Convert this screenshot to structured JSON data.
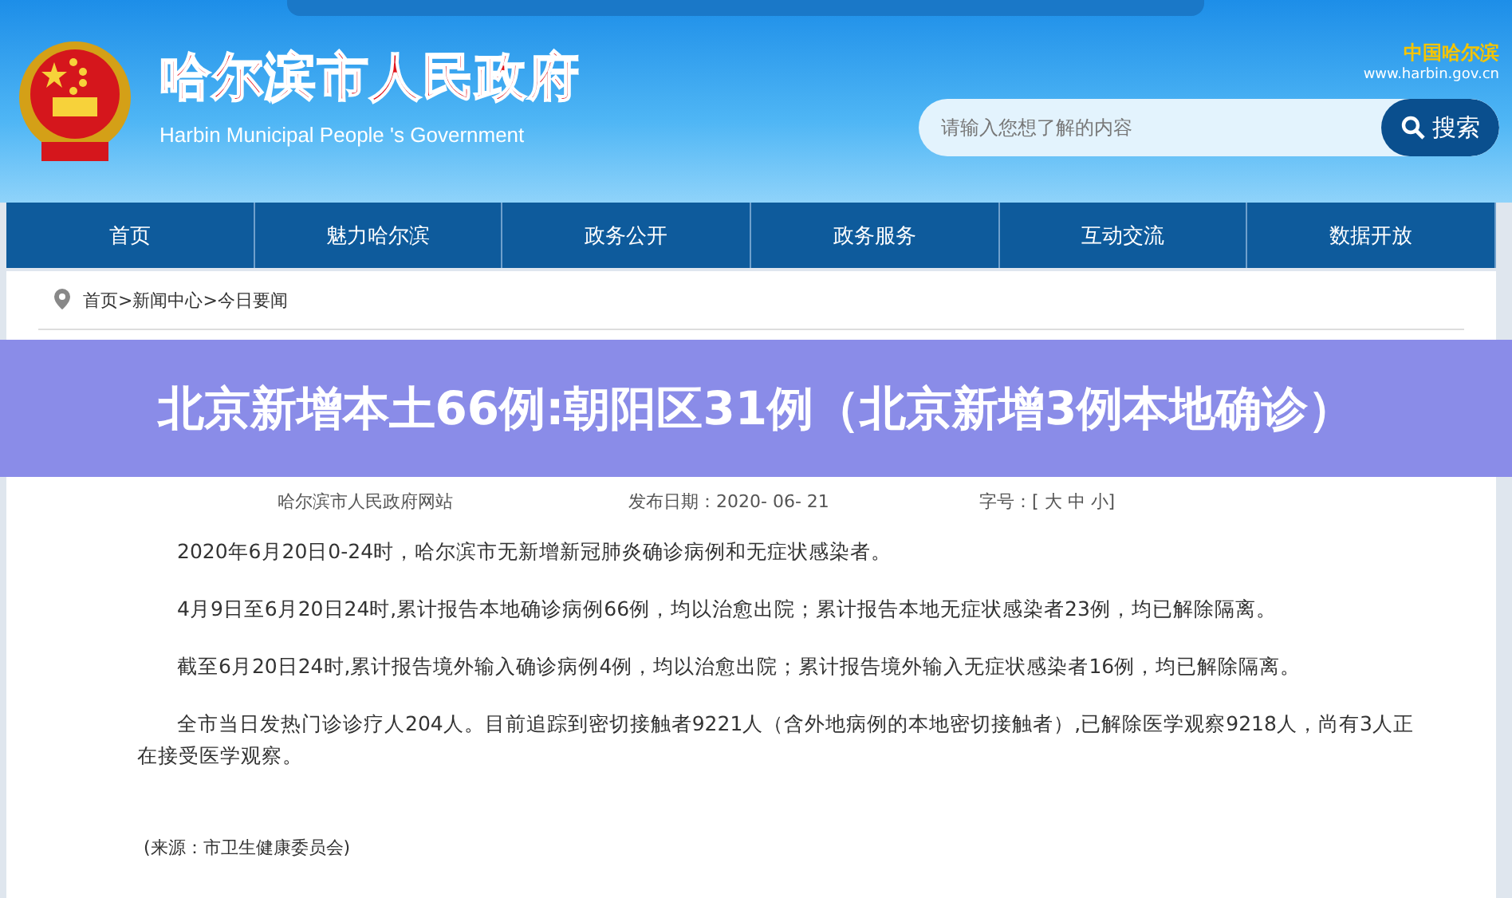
{
  "header": {
    "site_title": "哈尔滨市人民政府",
    "site_subtitle": "Harbin Municipal People 's Government",
    "city_logo": "中国哈尔滨",
    "city_url": "www.harbin.gov.cn",
    "search": {
      "placeholder": "请输入您想了解的内容",
      "button": "搜索"
    }
  },
  "nav": [
    {
      "label": "首页"
    },
    {
      "label": "魅力哈尔滨"
    },
    {
      "label": "政务公开"
    },
    {
      "label": "政务服务"
    },
    {
      "label": "互动交流"
    },
    {
      "label": "数据开放"
    }
  ],
  "breadcrumb": "首页>新闻中心>今日要闻",
  "banner": "北京新增本土66例:朝阳区31例（北京新增3例本地确诊）",
  "article": {
    "source": "哈尔滨市人民政府网站",
    "date": "发布日期：2020- 06- 21",
    "font_size": "字号：[ 大 中 小]",
    "paragraphs": [
      "2020年6月20日0-24时，哈尔滨市无新增新冠肺炎确诊病例和无症状感染者。",
      "4月9日至6月20日24时,累计报告本地确诊病例66例，均以治愈出院；累计报告本地无症状感染者23例，均已解除隔离。",
      "截至6月20日24时,累计报告境外输入确诊病例4例，均以治愈出院；累计报告境外输入无症状感染者16例，均已解除隔离。",
      "全市当日发热门诊诊疗人204人。目前追踪到密切接触者9221人（含外地病例的本地密切接触者）,已解除医学观察9218人，尚有3人正在接受医学观察。"
    ],
    "footer_source": "(来源：市卫生健康委员会)"
  }
}
